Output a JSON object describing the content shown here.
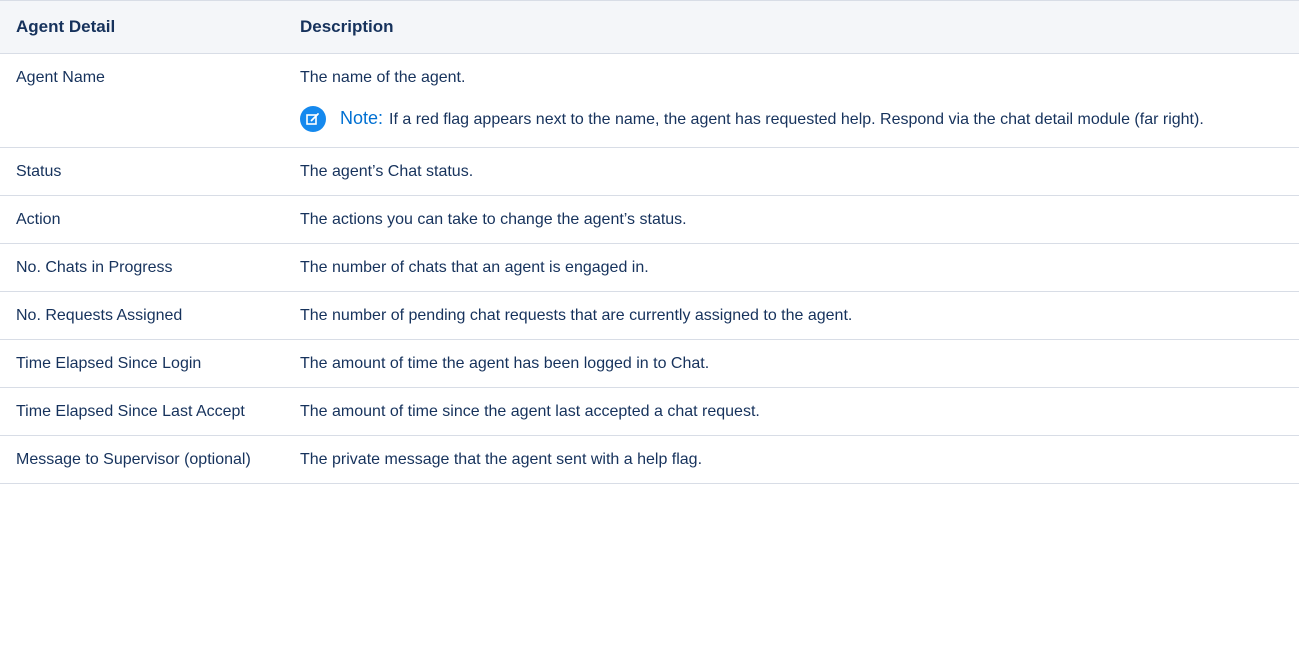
{
  "table": {
    "headers": [
      "Agent Detail",
      "Description"
    ],
    "rows": [
      {
        "detail": "Agent Name",
        "description": "The name of the agent.",
        "note": {
          "icon": "note-edit-icon",
          "label": "Note:",
          "text": "If a red flag appears next to the name, the agent has requested help. Respond via the chat detail module (far right)."
        }
      },
      {
        "detail": "Status",
        "description": "The agent’s Chat status."
      },
      {
        "detail": "Action",
        "description": "The actions you can take to change the agent’s status."
      },
      {
        "detail": "No. Chats in Progress",
        "description": "The number of chats that an agent is engaged in."
      },
      {
        "detail": "No. Requests Assigned",
        "description": "The number of pending chat requests that are currently assigned to the agent."
      },
      {
        "detail": "Time Elapsed Since Login",
        "description": "The amount of time the agent has been logged in to Chat."
      },
      {
        "detail": "Time Elapsed Since Last Accept",
        "description": "The amount of time since the agent last accepted a chat request."
      },
      {
        "detail": "Message to Supervisor (optional)",
        "description": "The private message that the agent sent with a help flag."
      }
    ]
  },
  "colors": {
    "text": "#16325c",
    "header_bg": "#f4f6f9",
    "border": "#d8dde6",
    "note_label": "#0070d2",
    "note_icon_bg": "#1589ee"
  }
}
